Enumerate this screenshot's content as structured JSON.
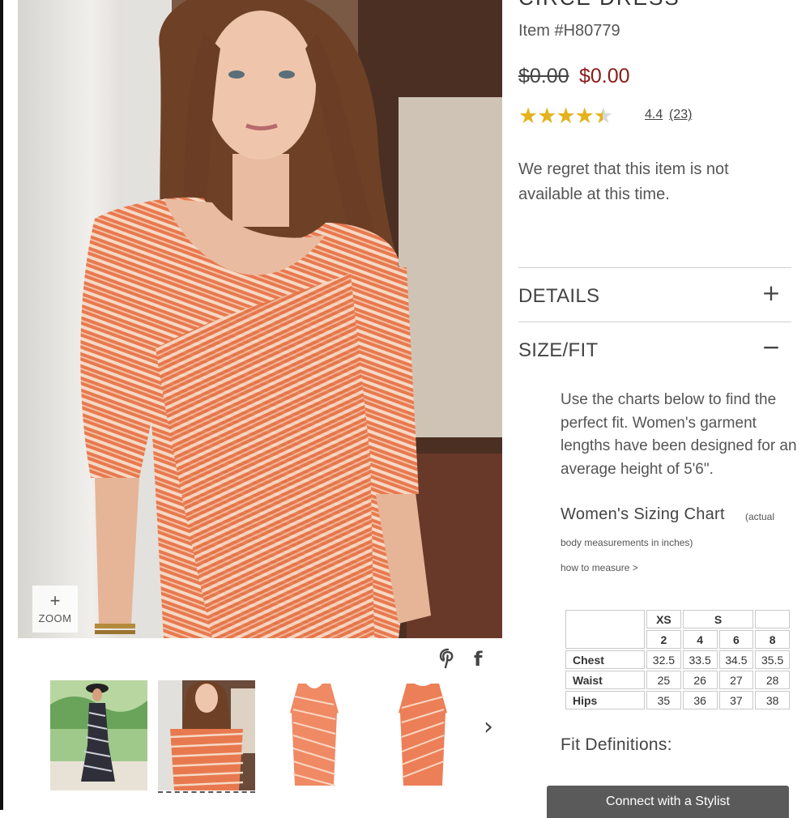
{
  "product": {
    "title_partial": "CIRCE DRESS",
    "item_number": "Item #H80779",
    "price_original": "$0.00",
    "price_sale": "$0.00",
    "rating": {
      "value": "4.4",
      "count": "(23)",
      "stars_filled": 4.4,
      "stars_total": 5
    },
    "availability": "We regret that this item is not available at this time."
  },
  "gallery": {
    "zoom_label": "ZOOM",
    "zoom_icon": "plus-icon",
    "share_icons": [
      "pinterest-icon",
      "facebook-icon"
    ],
    "thumbnails": [
      {
        "name": "thumb-beach-model"
      },
      {
        "name": "thumb-model-closeup",
        "active": true
      },
      {
        "name": "thumb-dress-front"
      },
      {
        "name": "thumb-dress-back"
      }
    ],
    "next_icon": "chevron-right-icon"
  },
  "accordion": {
    "details": {
      "label": "DETAILS",
      "toggle": "+"
    },
    "size_fit": {
      "label": "SIZE/FIT",
      "toggle": "−"
    }
  },
  "size_fit": {
    "intro": "Use the charts below to find the perfect fit. Women's garment lengths have been designed for an average height of 5'6\".",
    "chart_title": "Women's Sizing Chart",
    "chart_note_line1": "(actual",
    "chart_note_line2": "body measurements in inches)",
    "how_to_measure": "how to measure >",
    "table": {
      "sizes": [
        "XS",
        "S"
      ],
      "numbers": [
        "2",
        "4",
        "6",
        "8"
      ],
      "rows": [
        {
          "label": "Chest",
          "values": [
            "32.5",
            "33.5",
            "34.5",
            "35.5"
          ]
        },
        {
          "label": "Waist",
          "values": [
            "25",
            "26",
            "27",
            "28"
          ]
        },
        {
          "label": "Hips",
          "values": [
            "35",
            "36",
            "37",
            "38"
          ]
        }
      ]
    },
    "fit_definitions": "Fit Definitions:"
  },
  "stylist_button": "Connect with a Stylist",
  "colors": {
    "sale_price": "#8b1a1a",
    "star": "#e4b21c",
    "dress": "#e8794f",
    "stylist_button_bg": "#5a5a5a"
  }
}
